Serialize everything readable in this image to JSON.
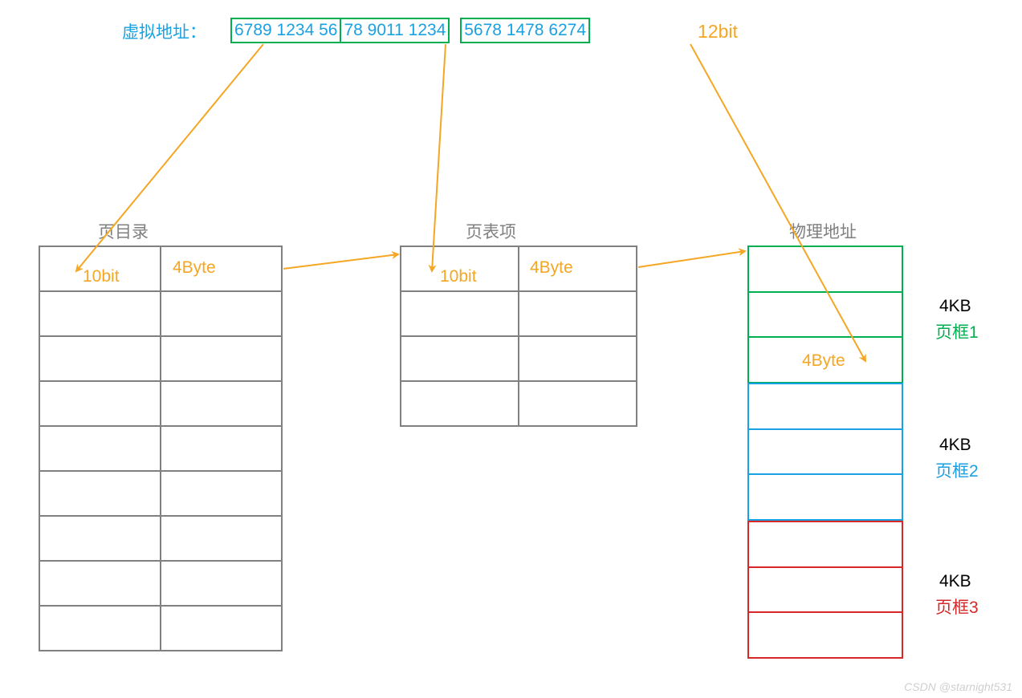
{
  "address": {
    "label_prefix": "虚拟地址：",
    "part1": "6789 1234 56",
    "part2": "78 9011 1234",
    "part3": "5678 1478 6274",
    "suffix_label": "12bit"
  },
  "tables": {
    "page_dir": {
      "title": "页目录",
      "cell1": "10bit",
      "cell2": "4Byte"
    },
    "page_entry": {
      "title": "页表项",
      "cell1": "10bit",
      "cell2": "4Byte"
    },
    "phys": {
      "title": "物理地址",
      "cell_label": "4Byte"
    }
  },
  "frames": {
    "f1": {
      "size": "4KB",
      "name": "页框1"
    },
    "f2": {
      "size": "4KB",
      "name": "页框2"
    },
    "f3": {
      "size": "4KB",
      "name": "页框3"
    }
  },
  "watermark": "CSDN @starnight531",
  "colors": {
    "blue": "#1aa1e2",
    "orange": "#f5a623",
    "gray": "#808080",
    "green": "#00b050",
    "red": "#d62828"
  }
}
